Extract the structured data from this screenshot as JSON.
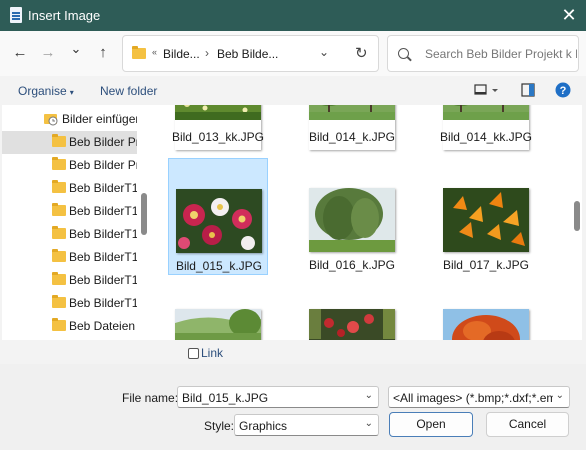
{
  "window": {
    "title": "Insert Image",
    "close_glyph": "✕"
  },
  "nav": {
    "back_glyph": "←",
    "forward_glyph": "→",
    "recent_glyph": "⌄",
    "up_glyph": "↑",
    "address": {
      "overflow": "«",
      "segments": [
        "Bilde...",
        "Beb Bilde..."
      ],
      "separator": "›",
      "dropdown_glyph": "⌄",
      "refresh_glyph": "↻"
    },
    "search_placeholder": "Search Beb Bilder Projekt k L..."
  },
  "commands": {
    "organise": "Organise",
    "new_folder": "New folder",
    "caret": "▾"
  },
  "tree": [
    {
      "label": "Bilder einfügen",
      "icon": "special-folder-icon"
    },
    {
      "label": "Beb Bilder Pro",
      "icon": "folder-icon",
      "selected": true
    },
    {
      "label": "Beb Bilder Pro",
      "icon": "folder-icon"
    },
    {
      "label": "Beb BilderT1",
      "icon": "folder-icon"
    },
    {
      "label": "Beb BilderT1",
      "icon": "folder-icon"
    },
    {
      "label": "Beb BilderT1",
      "icon": "folder-icon"
    },
    {
      "label": "Beb BilderT1",
      "icon": "folder-icon"
    },
    {
      "label": "Beb BilderT1",
      "icon": "folder-icon"
    },
    {
      "label": "Beb BilderT1",
      "icon": "folder-icon"
    },
    {
      "label": "Beb Dateien I",
      "icon": "folder-icon"
    }
  ],
  "files": [
    {
      "name": "Bild_013_kk.JPG",
      "image": "meadow-flowers-photo"
    },
    {
      "name": "Bild_014_k.JPG",
      "image": "park-trees-photo"
    },
    {
      "name": "Bild_014_kk.JPG",
      "image": "park-trees-photo"
    },
    {
      "name": "Bild_015_k.JPG",
      "image": "pink-dahlias-photo",
      "selected": true
    },
    {
      "name": "Bild_016_k.JPG",
      "image": "weeping-willow-photo"
    },
    {
      "name": "Bild_017_k.JPG",
      "image": "orange-lilies-photo"
    },
    {
      "name": "",
      "image": "hill-landscape-photo"
    },
    {
      "name": "",
      "image": "red-berries-photo"
    },
    {
      "name": "",
      "image": "autumn-tree-photo"
    }
  ],
  "link_checkbox": {
    "label": "Link",
    "checked": false
  },
  "bottom": {
    "file_name_label": "File name:",
    "file_name_value": "Bild_015_k.JPG",
    "file_type_value": "<All images> (*.bmp;*.dxf;*.emf",
    "style_label": "Style:",
    "style_value": "Graphics",
    "open_label": "Open",
    "cancel_label": "Cancel",
    "dropdown_glyph": "⌄"
  }
}
